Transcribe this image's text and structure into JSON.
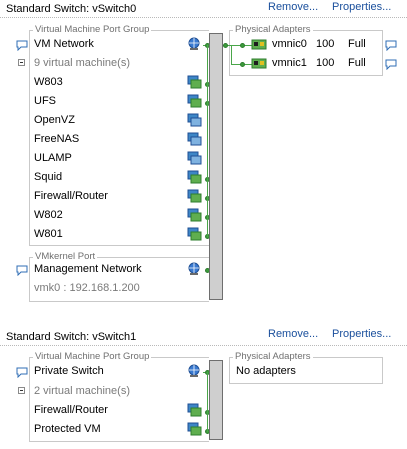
{
  "switch0": {
    "title": "Standard Switch: vSwitch0",
    "remove_link": "Remove...",
    "properties_link": "Properties...",
    "vm_port_group": {
      "group_label": "Virtual Machine Port Group",
      "name": "VM Network",
      "vm_count_label": "9 virtual machine(s)",
      "vms": [
        {
          "name": "W803",
          "connected": true
        },
        {
          "name": "UFS",
          "connected": true
        },
        {
          "name": "OpenVZ",
          "connected": false
        },
        {
          "name": "FreeNAS",
          "connected": false
        },
        {
          "name": "ULAMP",
          "connected": false
        },
        {
          "name": "Squid",
          "connected": true
        },
        {
          "name": "Firewall/Router",
          "connected": true
        },
        {
          "name": "W802",
          "connected": true
        },
        {
          "name": "W801",
          "connected": true
        }
      ]
    },
    "vmkernel_port": {
      "group_label": "VMkernel Port",
      "name": "Management Network",
      "address": "vmk0 : 192.168.1.200"
    },
    "physical_adapters": {
      "group_label": "Physical Adapters",
      "adapters": [
        {
          "name": "vmnic0",
          "speed": "100",
          "duplex": "Full"
        },
        {
          "name": "vmnic1",
          "speed": "100",
          "duplex": "Full"
        }
      ]
    }
  },
  "switch1": {
    "title": "Standard Switch: vSwitch1",
    "remove_link": "Remove...",
    "properties_link": "Properties...",
    "vm_port_group": {
      "group_label": "Virtual Machine Port Group",
      "name": "Private Switch",
      "vm_count_label": "2 virtual machine(s)",
      "vms": [
        {
          "name": "Firewall/Router",
          "connected": true
        },
        {
          "name": "Protected VM",
          "connected": true
        }
      ]
    },
    "physical_adapters": {
      "group_label": "Physical Adapters",
      "no_adapters_text": "No adapters"
    }
  },
  "colors": {
    "link": "#1a4f9c",
    "connection_green": "#3c9b3c",
    "bus_gray": "#cfcfcf",
    "border_gray": "#c9c9c9"
  }
}
